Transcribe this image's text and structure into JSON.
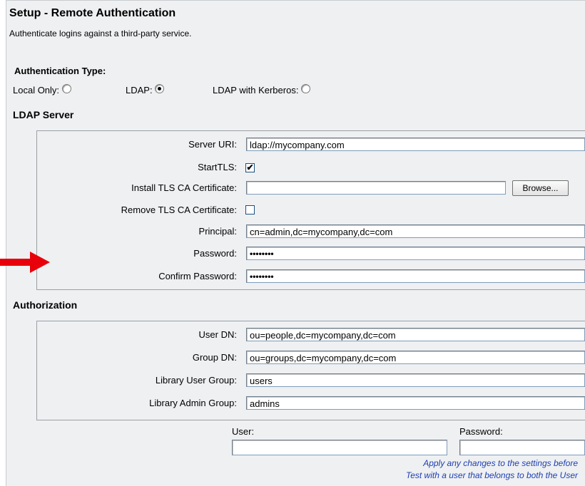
{
  "header": {
    "title": "Setup - Remote Authentication",
    "subtitle": "Authenticate logins against a third-party service."
  },
  "auth_type": {
    "heading": "Authentication Type:",
    "options": [
      {
        "label": "Local Only:",
        "selected": false
      },
      {
        "label": "LDAP:",
        "selected": true
      },
      {
        "label": "LDAP with Kerberos:",
        "selected": false
      }
    ]
  },
  "ldap_server": {
    "heading": "LDAP Server",
    "server_uri_label": "Server URI:",
    "server_uri_value": "ldap://mycompany.com",
    "starttls_label": "StartTLS:",
    "starttls_checked": true,
    "install_ca_label": "Install TLS CA Certificate:",
    "install_ca_value": "",
    "browse_label": "Browse...",
    "remove_ca_label": "Remove TLS CA Certificate:",
    "remove_ca_checked": false,
    "principal_label": "Principal:",
    "principal_value": "cn=admin,dc=mycompany,dc=com",
    "password_label": "Password:",
    "password_value": "••••••••",
    "confirm_label": "Confirm Password:",
    "confirm_value": "••••••••"
  },
  "authorization": {
    "heading": "Authorization",
    "user_dn_label": "User DN:",
    "user_dn_value": "ou=people,dc=mycompany,dc=com",
    "group_dn_label": "Group DN:",
    "group_dn_value": "ou=groups,dc=mycompany,dc=com",
    "lib_user_label": "Library User Group:",
    "lib_user_value": "users",
    "lib_admin_label": "Library Admin Group:",
    "lib_admin_value": "admins"
  },
  "test": {
    "user_label": "User:",
    "user_value": "",
    "password_label": "Password:",
    "password_value": "",
    "note_line1": "Apply any changes to the settings before",
    "note_line2": "Test with a user that belongs to both the User"
  },
  "colors": {
    "arrow": "#e8000b",
    "note": "#1f3fb0"
  }
}
